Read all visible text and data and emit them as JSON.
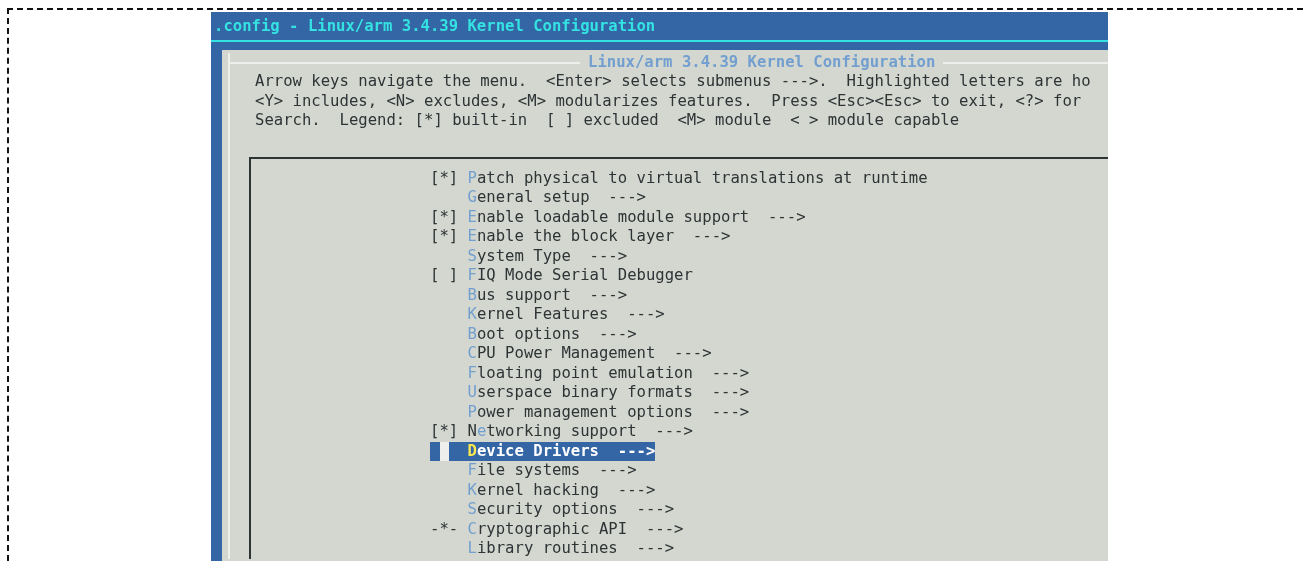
{
  "window": {
    "title": ".config - Linux/arm 3.4.39 Kernel Configuration"
  },
  "dialog": {
    "title": "Linux/arm 3.4.39 Kernel Configuration",
    "help": [
      "Arrow keys navigate the menu.  <Enter> selects submenus --->.  Highlighted letters are ho",
      "<Y> includes, <N> excludes, <M> modularizes features.  Press <Esc><Esc> to exit, <?> for",
      "Search.  Legend: [*] built-in  [ ] excluded  <M> module  < > module capable"
    ]
  },
  "menu": {
    "items": [
      {
        "prefix": "[*]",
        "label": "**P**atch physical to virtual translations at runtime",
        "selected": false
      },
      {
        "label": "**G**eneral setup  --->",
        "selected": false
      },
      {
        "prefix": "[*]",
        "label": "**E**nable loadable module support  --->",
        "selected": false
      },
      {
        "prefix": "[*]",
        "label": "**E**nable the block layer  --->",
        "selected": false
      },
      {
        "label": "**S**ystem Type  --->",
        "selected": false
      },
      {
        "prefix": "[ ]",
        "label": "**F**IQ Mode Serial Debugger",
        "selected": false
      },
      {
        "label": "**B**us support  --->",
        "selected": false
      },
      {
        "label": "**K**ernel Features  --->",
        "selected": false
      },
      {
        "label": "**B**oot options  --->",
        "selected": false
      },
      {
        "label": "**C**PU Power Management  --->",
        "selected": false
      },
      {
        "label": "**F**loating point emulation  --->",
        "selected": false
      },
      {
        "label": "**U**serspace binary formats  --->",
        "selected": false
      },
      {
        "label": "**P**ower management options  --->",
        "selected": false
      },
      {
        "prefix": "[*]",
        "label": "N**e**tworking support  --->",
        "selected": false
      },
      {
        "label": "**D**evice Drivers  --->",
        "selected": true
      },
      {
        "label": "**F**ile systems  --->",
        "selected": false
      },
      {
        "label": "**K**ernel hacking  --->",
        "selected": false
      },
      {
        "label": "**S**ecurity options  --->",
        "selected": false
      },
      {
        "prefix": "-*-",
        "label": "**C**ryptographic API  --->",
        "selected": false
      },
      {
        "label": "**L**ibrary routines  --->",
        "selected": false
      }
    ]
  }
}
